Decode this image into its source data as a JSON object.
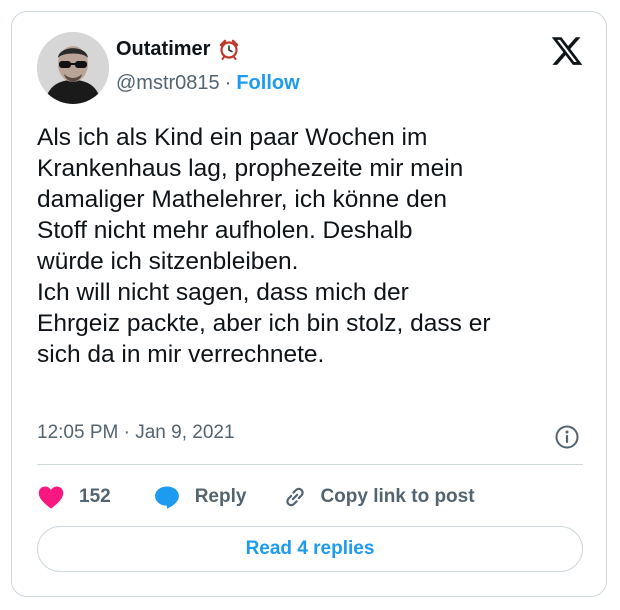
{
  "author": {
    "name": "Outatimer",
    "handle": "@mstr0815",
    "separator": "·",
    "follow_label": "Follow"
  },
  "tweet": {
    "text": "Als ich als Kind ein paar Wochen im\nKrankenhaus lag, prophezeite mir mein\ndamaliger Mathelehrer, ich könne den\nStoff nicht mehr aufholen. Deshalb\nwürde ich sitzenbleiben.\nIch will nicht sagen, dass mich der\nEhrgeiz packte, aber ich bin stolz, dass er\nsich da in mir verrechnete.",
    "timestamp": "12:05 PM · Jan 9, 2021"
  },
  "actions": {
    "like_count": "152",
    "reply_label": "Reply",
    "copy_link_label": "Copy link to post"
  },
  "read_replies_label": "Read 4 replies",
  "icons": {
    "name_badge": "alarm-clock-icon",
    "brand": "x-logo-icon",
    "info": "info-icon",
    "like": "heart-icon",
    "reply": "speech-bubble-icon",
    "copy": "link-icon"
  },
  "colors": {
    "accent": "#1d9bf0",
    "like": "#f91880",
    "text": "#0f1419",
    "secondary": "#536471",
    "border": "#cfd9de"
  }
}
